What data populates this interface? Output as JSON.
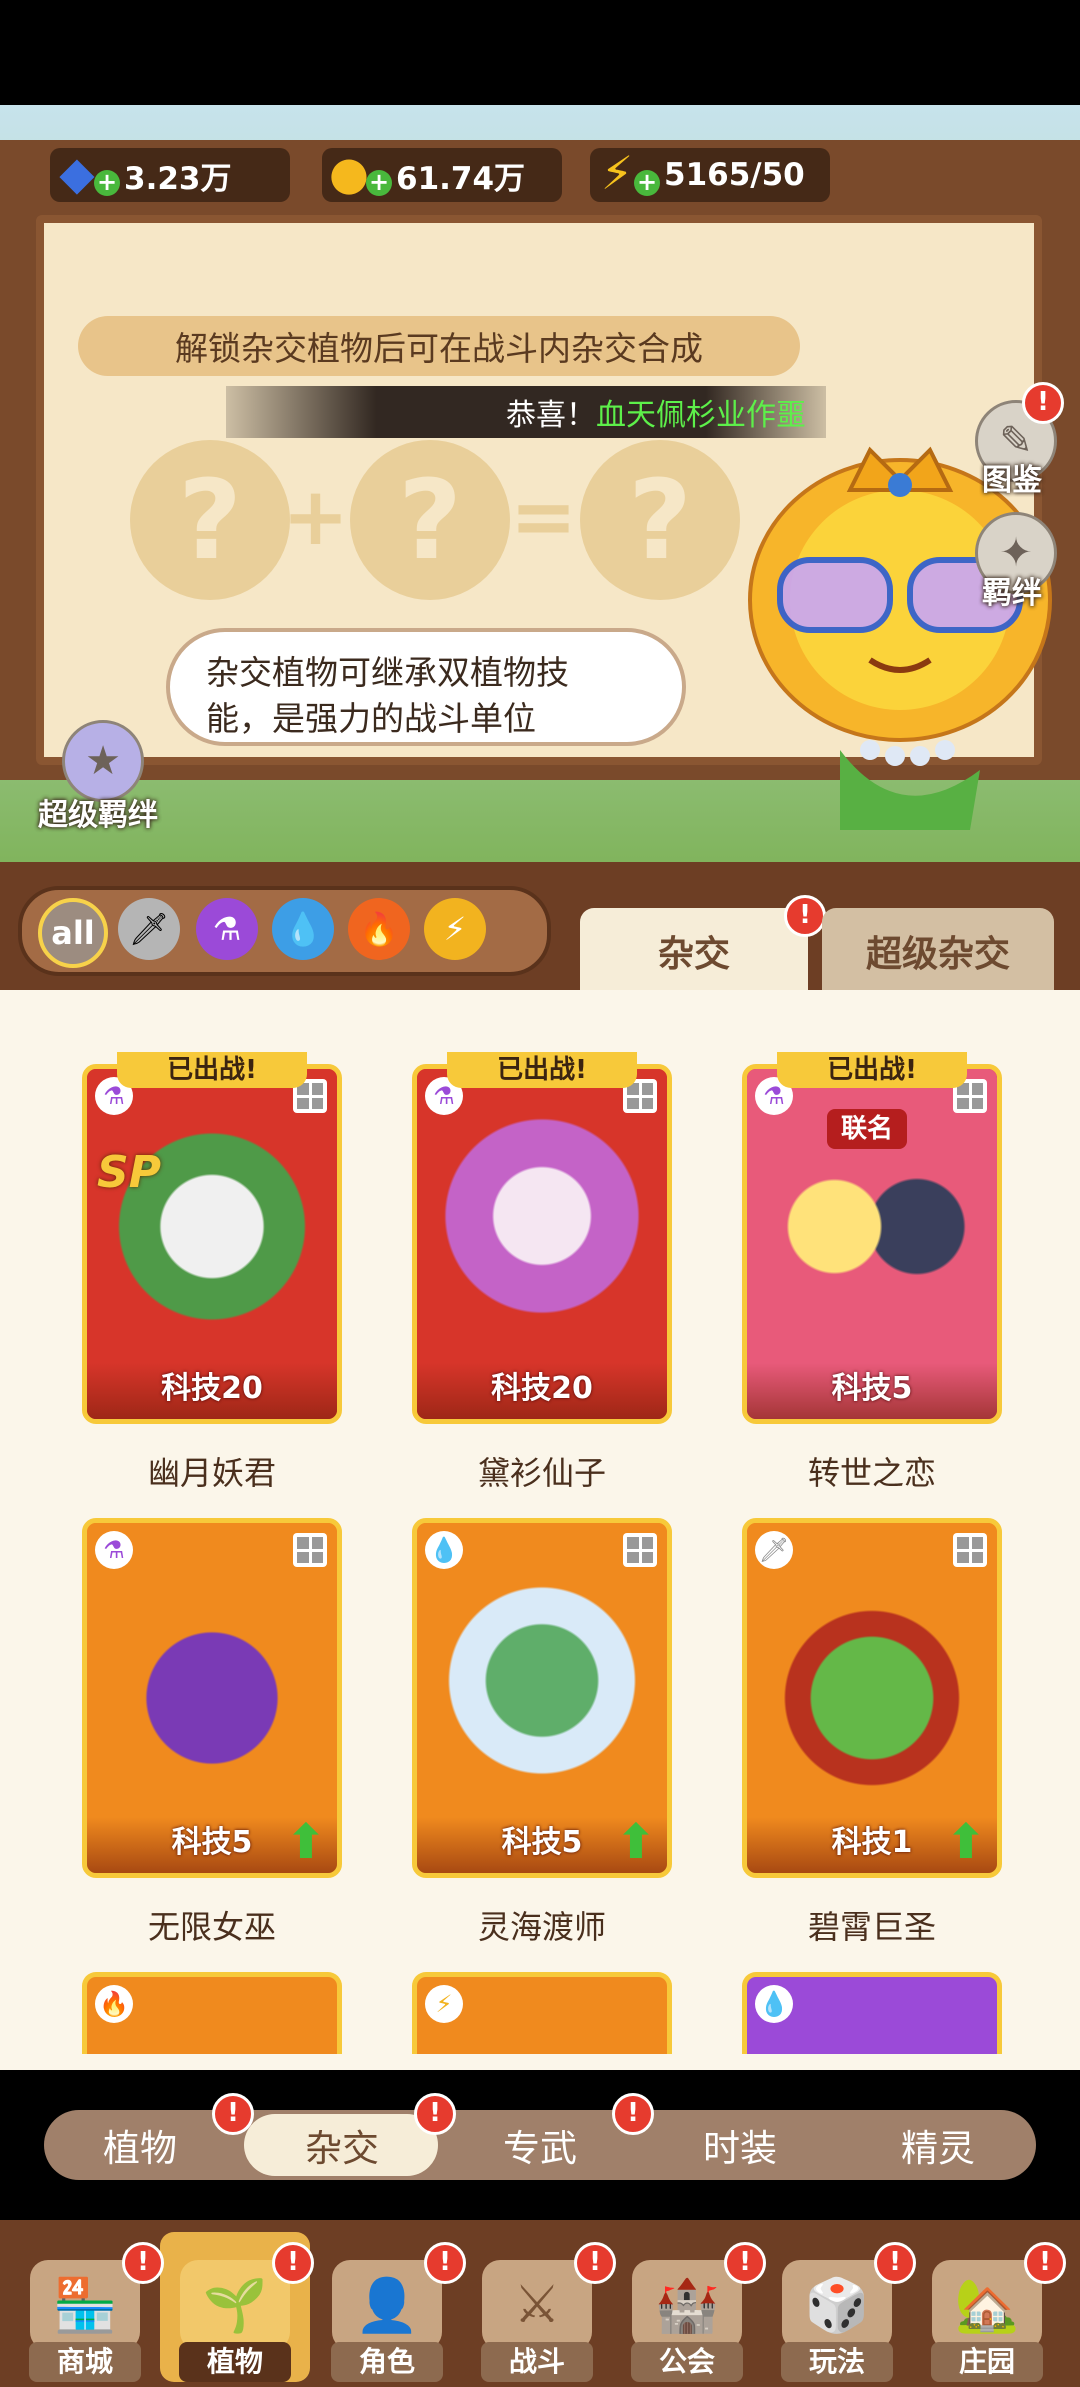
{
  "resources": {
    "gems": "3.23万",
    "coins": "61.74万",
    "energy": "5165/50"
  },
  "banner": {
    "unlock_text": "解锁杂交植物后可在战斗内杂交合成",
    "congrats_prefix": "恭喜！",
    "congrats_name": "血天佩杉业作噩",
    "speech_line1": "杂交植物可继承双植物技",
    "speech_line2": "能，是强力的战斗单位",
    "super_bond_label": "超级羁绊",
    "side_buttons": [
      {
        "label": "图鉴",
        "icon": "book-icon"
      },
      {
        "label": "羁绊",
        "icon": "star-icon"
      }
    ]
  },
  "filters": {
    "all_label": "all",
    "elements": [
      {
        "icon": "sword-icon",
        "color": "#9c9c9c"
      },
      {
        "icon": "potion-icon",
        "color": "#9b4ad8"
      },
      {
        "icon": "water-drop-icon",
        "color": "#3d9ee6"
      },
      {
        "icon": "fire-icon",
        "color": "#f0651f"
      },
      {
        "icon": "lightning-icon",
        "color": "#f2b31f"
      }
    ]
  },
  "top_tabs": {
    "hybrid": "杂交",
    "super_hybrid": "超级杂交"
  },
  "cards": [
    {
      "name": "幽月妖君",
      "tech": "科技20",
      "deployed": "已出战!",
      "sp": "SP",
      "element": "potion-icon",
      "bg": "#d7352a"
    },
    {
      "name": "黛衫仙子",
      "tech": "科技20",
      "deployed": "已出战!",
      "element": "potion-icon",
      "bg": "#d7352a"
    },
    {
      "name": "转世之恋",
      "tech": "科技5",
      "deployed": "已出战!",
      "tag": "联名",
      "element": "potion-icon",
      "bg": "#d7352a"
    },
    {
      "name": "无限女巫",
      "tech": "科技5",
      "element": "potion-icon",
      "bg": "#f08a1e"
    },
    {
      "name": "灵海渡师",
      "tech": "科技5",
      "element": "water-drop-icon",
      "bg": "#f08a1e"
    },
    {
      "name": "碧霄巨圣",
      "tech": "科技1",
      "element": "sword-icon",
      "bg": "#f08a1e"
    }
  ],
  "subnav": [
    "植物",
    "杂交",
    "专武",
    "时装",
    "精灵"
  ],
  "bottomnav": [
    "商城",
    "植物",
    "角色",
    "战斗",
    "公会",
    "玩法",
    "庄园"
  ]
}
